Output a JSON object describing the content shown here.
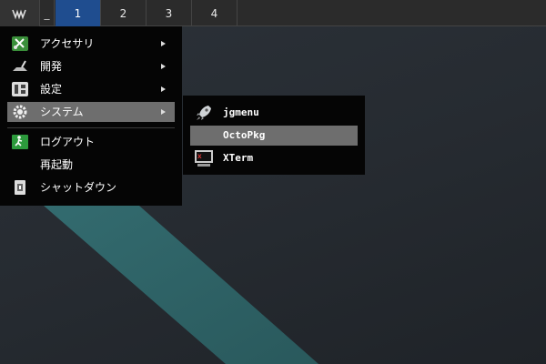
{
  "panel": {
    "logo_icon": "menu-logo-icon",
    "separator": "_",
    "workspaces": [
      {
        "label": "1",
        "active": true
      },
      {
        "label": "2",
        "active": false
      },
      {
        "label": "3",
        "active": false
      },
      {
        "label": "4",
        "active": false
      }
    ]
  },
  "menu": {
    "items": [
      {
        "label": "アクセサリ",
        "icon": "accessories-icon",
        "submenu": true
      },
      {
        "label": "開発",
        "icon": "development-icon",
        "submenu": true
      },
      {
        "label": "設定",
        "icon": "settings-icon",
        "submenu": true
      },
      {
        "label": "システム",
        "icon": "system-gear-icon",
        "submenu": true,
        "selected": true
      },
      {
        "label": "ログアウト",
        "icon": "logout-icon",
        "submenu": false
      },
      {
        "label": "再起動",
        "icon": "",
        "submenu": false
      },
      {
        "label": "シャットダウン",
        "icon": "shutdown-icon",
        "submenu": false
      }
    ]
  },
  "submenu": {
    "items": [
      {
        "label": "jgmenu",
        "icon": "rocket-icon"
      },
      {
        "label": "OctoPkg",
        "icon": "",
        "selected": true
      },
      {
        "label": "XTerm",
        "icon": "terminal-icon"
      }
    ]
  },
  "colors": {
    "panel_bg": "#2b2b2b",
    "active_workspace": "#1f4d8f",
    "menu_bg": "#050505",
    "selection": "#6e6e6e",
    "wallpaper_stripe": "#2e6266"
  }
}
